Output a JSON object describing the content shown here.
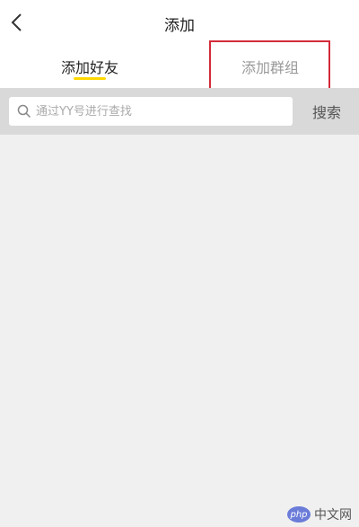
{
  "header": {
    "back_icon": "chevron-left-icon",
    "title": "添加"
  },
  "tabs": [
    {
      "label": "添加好友",
      "active": true
    },
    {
      "label": "添加群组",
      "active": false
    }
  ],
  "search": {
    "icon": "search-icon",
    "placeholder": "通过YY号进行查找",
    "value": "",
    "button_label": "搜索"
  },
  "watermark": {
    "logo_text": "php",
    "text": "中文网"
  },
  "colors": {
    "tab_underline": "#ffd800",
    "highlight_box": "#d42b3a",
    "search_bar_bg": "#d9d9d9",
    "content_bg": "#f0f0f0"
  }
}
